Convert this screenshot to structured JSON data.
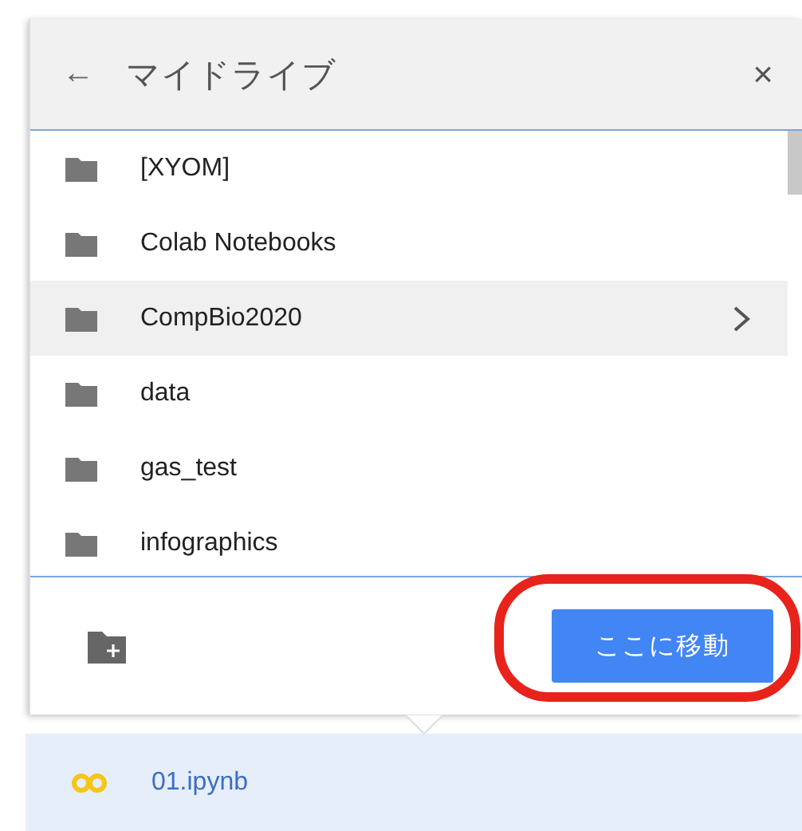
{
  "dialog": {
    "title": "マイドライブ",
    "back_icon": "←",
    "close_icon": "×",
    "folders": [
      {
        "name": "[XYOM]",
        "selected": false
      },
      {
        "name": "Colab Notebooks",
        "selected": false
      },
      {
        "name": "CompBio2020",
        "selected": true
      },
      {
        "name": "data",
        "selected": false
      },
      {
        "name": "gas_test",
        "selected": false
      },
      {
        "name": "infographics",
        "selected": false
      }
    ],
    "move_button": "ここに移動"
  },
  "file": {
    "name": "01.ipynb"
  }
}
